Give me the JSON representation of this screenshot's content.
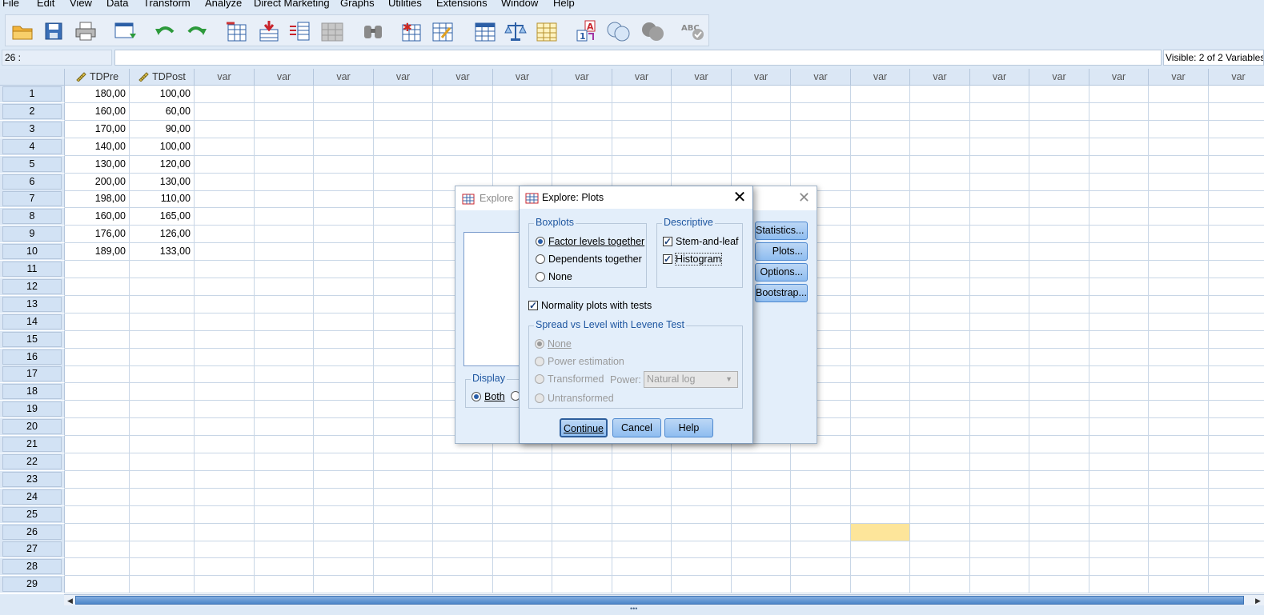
{
  "menubar": {
    "items": [
      "File",
      "Edit",
      "View",
      "Data",
      "Transform",
      "Analyze",
      "Direct Marketing",
      "Graphs",
      "Utilities",
      "Extensions",
      "Window",
      "Help"
    ]
  },
  "refbar": {
    "cell_ref": "26 :",
    "visible": "Visible: 2 of 2 Variables"
  },
  "grid": {
    "columns": [
      "TDPre",
      "TDPost"
    ],
    "var_label": "var",
    "rows": [
      [
        "180,00",
        "100,00"
      ],
      [
        "160,00",
        "60,00"
      ],
      [
        "170,00",
        "90,00"
      ],
      [
        "140,00",
        "100,00"
      ],
      [
        "130,00",
        "120,00"
      ],
      [
        "200,00",
        "130,00"
      ],
      [
        "198,00",
        "110,00"
      ],
      [
        "160,00",
        "165,00"
      ],
      [
        "176,00",
        "126,00"
      ],
      [
        "189,00",
        "133,00"
      ]
    ],
    "row_count": 29,
    "selected_row": 26
  },
  "explore": {
    "title": "Explore",
    "buttons": [
      "Statistics...",
      "Plots...",
      "Options...",
      "Bootstrap..."
    ],
    "display_label": "Display",
    "display_both": "Both"
  },
  "plots": {
    "title": "Explore: Plots",
    "boxplots": {
      "label": "Boxplots",
      "options": [
        "Factor levels together",
        "Dependents together",
        "None"
      ],
      "selected": "Factor levels together"
    },
    "descriptive": {
      "label": "Descriptive",
      "stem_and_leaf": "Stem-and-leaf",
      "histogram": "Histogram"
    },
    "normality": "Normality plots with tests",
    "spread": {
      "label": "Spread vs Level with Levene Test",
      "options": [
        "None",
        "Power estimation",
        "Transformed",
        "Untransformed"
      ],
      "power_label": "Power:",
      "power_value": "Natural log"
    },
    "buttons": {
      "continue": "Continue",
      "cancel": "Cancel",
      "help": "Help"
    }
  }
}
